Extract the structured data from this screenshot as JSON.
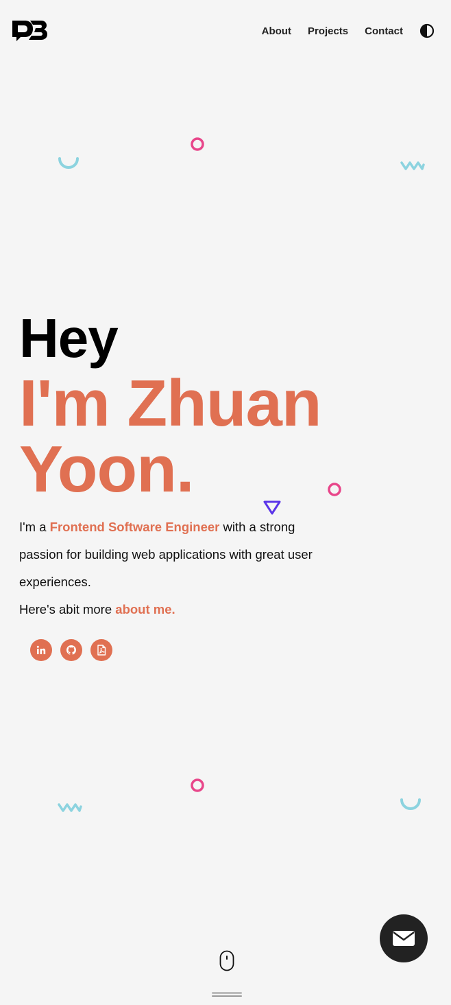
{
  "header": {
    "logo_text": "ZB",
    "nav": [
      {
        "label": "About"
      },
      {
        "label": "Projects"
      },
      {
        "label": "Contact"
      }
    ],
    "theme_toggle_icon": "contrast-icon"
  },
  "hero": {
    "greeting": "Hey",
    "name_line1": "I'm Zhuan",
    "name_line2": "Yoon.",
    "intro_prefix": "I'm a ",
    "intro_role": "Frontend Software Engineer",
    "intro_suffix": " with a strong passion for building web applications with great user experiences.",
    "more_prefix": "Here's abit more ",
    "more_link": "about me."
  },
  "socials": [
    {
      "icon": "linkedin-icon"
    },
    {
      "icon": "github-icon"
    },
    {
      "icon": "pdf-resume-icon"
    }
  ],
  "contact_button_icon": "envelope-icon",
  "scroll_indicator_icon": "mouse-icon",
  "colors": {
    "background": "#f5f5f5",
    "accent": "#e07052",
    "pink": "#e8468a",
    "cyan": "#8cd3df",
    "violet": "#5b35e8",
    "dark": "#222222"
  }
}
